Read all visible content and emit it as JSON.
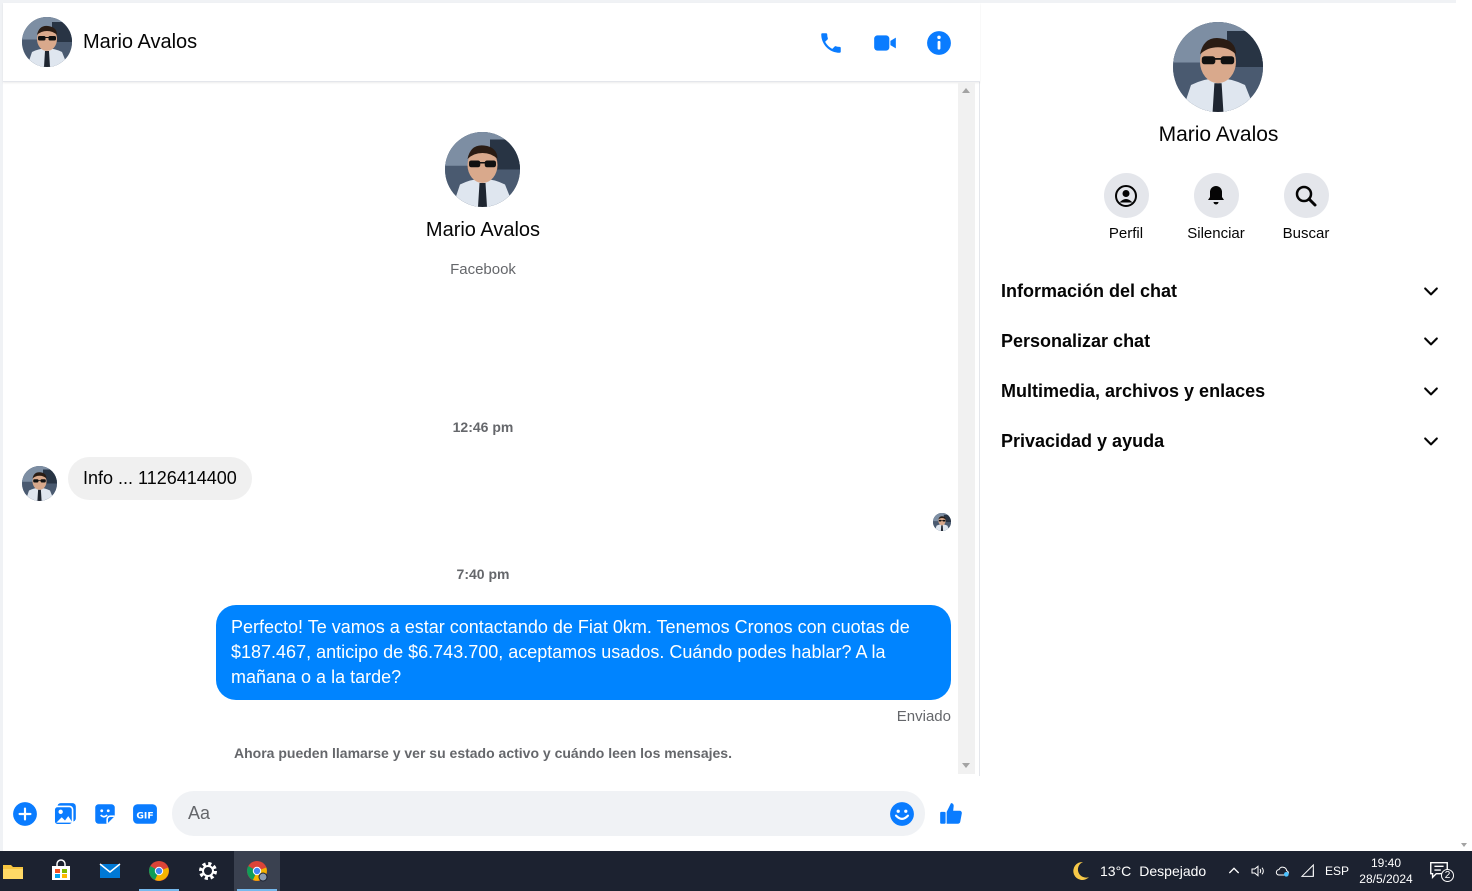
{
  "contact": {
    "name": "Mario Avalos",
    "source": "Facebook"
  },
  "header": {
    "call_icon": "phone-icon",
    "video_icon": "video-camera-icon",
    "info_icon": "info-icon"
  },
  "thread": {
    "timestamps": [
      "12:46 pm",
      "7:40 pm"
    ],
    "incoming_message": "Info ... 1126414400",
    "outgoing_message": "Perfecto! Te vamos a estar contactando de Fiat 0km. Tenemos Cronos con cuotas de $187.467, anticipo de $6.743.700, aceptamos usados. Cuándo podes hablar? A la mañana o a la tarde?",
    "sent_status": "Enviado",
    "notice": "Ahora pueden llamarse y ver su estado activo y cuándo leen los mensajes."
  },
  "composer": {
    "placeholder": "Aa"
  },
  "info_panel": {
    "actions": [
      {
        "label": "Perfil",
        "icon": "user-circle-icon"
      },
      {
        "label": "Silenciar",
        "icon": "bell-icon"
      },
      {
        "label": "Buscar",
        "icon": "search-icon"
      }
    ],
    "sections": [
      "Información del chat",
      "Personalizar chat",
      "Multimedia, archivos y enlaces",
      "Privacidad y ayuda"
    ]
  },
  "taskbar": {
    "weather": {
      "temp": "13°C",
      "condition": "Despejado"
    },
    "language": "ESP",
    "time": "19:40",
    "date": "28/5/2024",
    "notification_count": "2"
  },
  "colors": {
    "accent": "#0084ff",
    "messenger_blue": "#0a7cff",
    "bubble_in": "#f0f0f0",
    "taskbar": "#1c2230"
  }
}
